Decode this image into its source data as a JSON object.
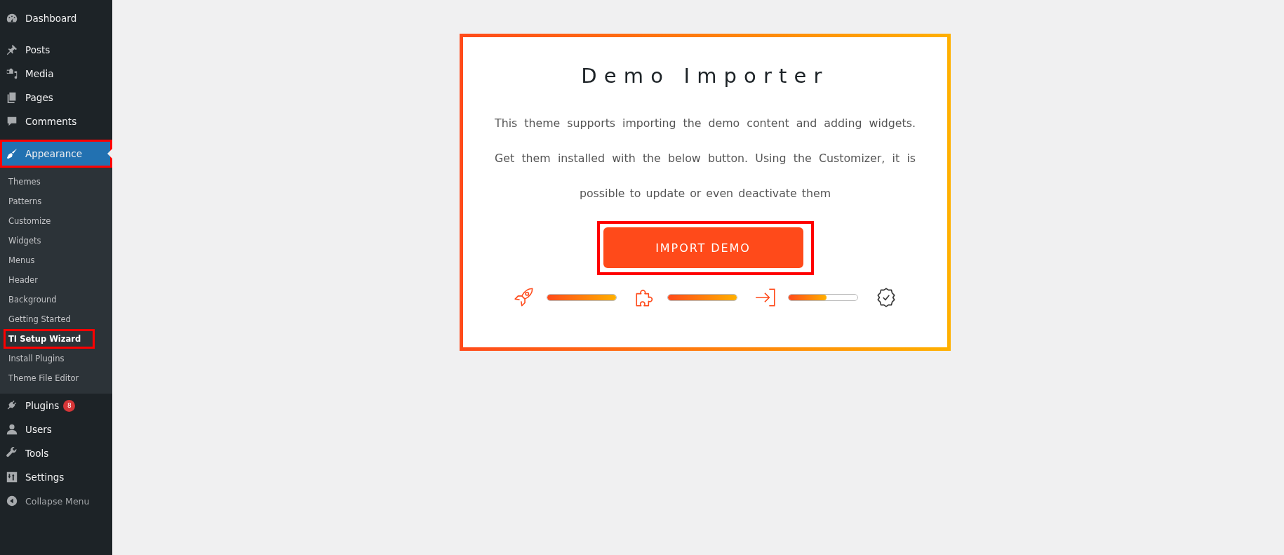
{
  "sidebar": {
    "items": [
      {
        "label": "Dashboard",
        "kind": "gauge",
        "selected": false,
        "outlined": false
      },
      {
        "label": "Posts",
        "kind": "pin",
        "selected": false,
        "outlined": false
      },
      {
        "label": "Media",
        "kind": "media",
        "selected": false,
        "outlined": false
      },
      {
        "label": "Pages",
        "kind": "pages",
        "selected": false,
        "outlined": false
      },
      {
        "label": "Comments",
        "kind": "comment",
        "selected": false,
        "outlined": false
      },
      {
        "label": "Appearance",
        "kind": "brush",
        "selected": true,
        "outlined": true,
        "children": [
          {
            "label": "Themes",
            "selected": false,
            "outlined": false
          },
          {
            "label": "Patterns",
            "selected": false,
            "outlined": false
          },
          {
            "label": "Customize",
            "selected": false,
            "outlined": false
          },
          {
            "label": "Widgets",
            "selected": false,
            "outlined": false
          },
          {
            "label": "Menus",
            "selected": false,
            "outlined": false
          },
          {
            "label": "Header",
            "selected": false,
            "outlined": false
          },
          {
            "label": "Background",
            "selected": false,
            "outlined": false
          },
          {
            "label": "Getting Started",
            "selected": false,
            "outlined": false
          },
          {
            "label": "TI Setup Wizard",
            "selected": true,
            "outlined": true
          },
          {
            "label": "Install Plugins",
            "selected": false,
            "outlined": false
          },
          {
            "label": "Theme File Editor",
            "selected": false,
            "outlined": false
          }
        ]
      },
      {
        "label": "Plugins",
        "kind": "plug",
        "selected": false,
        "outlined": false,
        "badge": "8"
      },
      {
        "label": "Users",
        "kind": "user",
        "selected": false,
        "outlined": false
      },
      {
        "label": "Tools",
        "kind": "wrench",
        "selected": false,
        "outlined": false
      },
      {
        "label": "Settings",
        "kind": "sliders",
        "selected": false,
        "outlined": false
      }
    ],
    "collapse": "Collapse Menu"
  },
  "importer": {
    "title": "Demo Importer",
    "description": "This theme supports importing the demo content and adding widgets. Get them installed with the below button. Using the Customizer, it is possible to update or even deactivate them",
    "button": {
      "label": "IMPORT DEMO",
      "outlined": true
    },
    "steps": [
      {
        "kind": "rocket",
        "level": 1
      },
      {
        "kind": "puzzle",
        "level": 1
      },
      {
        "kind": "enter",
        "level": 0.55
      },
      {
        "kind": "badge"
      }
    ]
  }
}
